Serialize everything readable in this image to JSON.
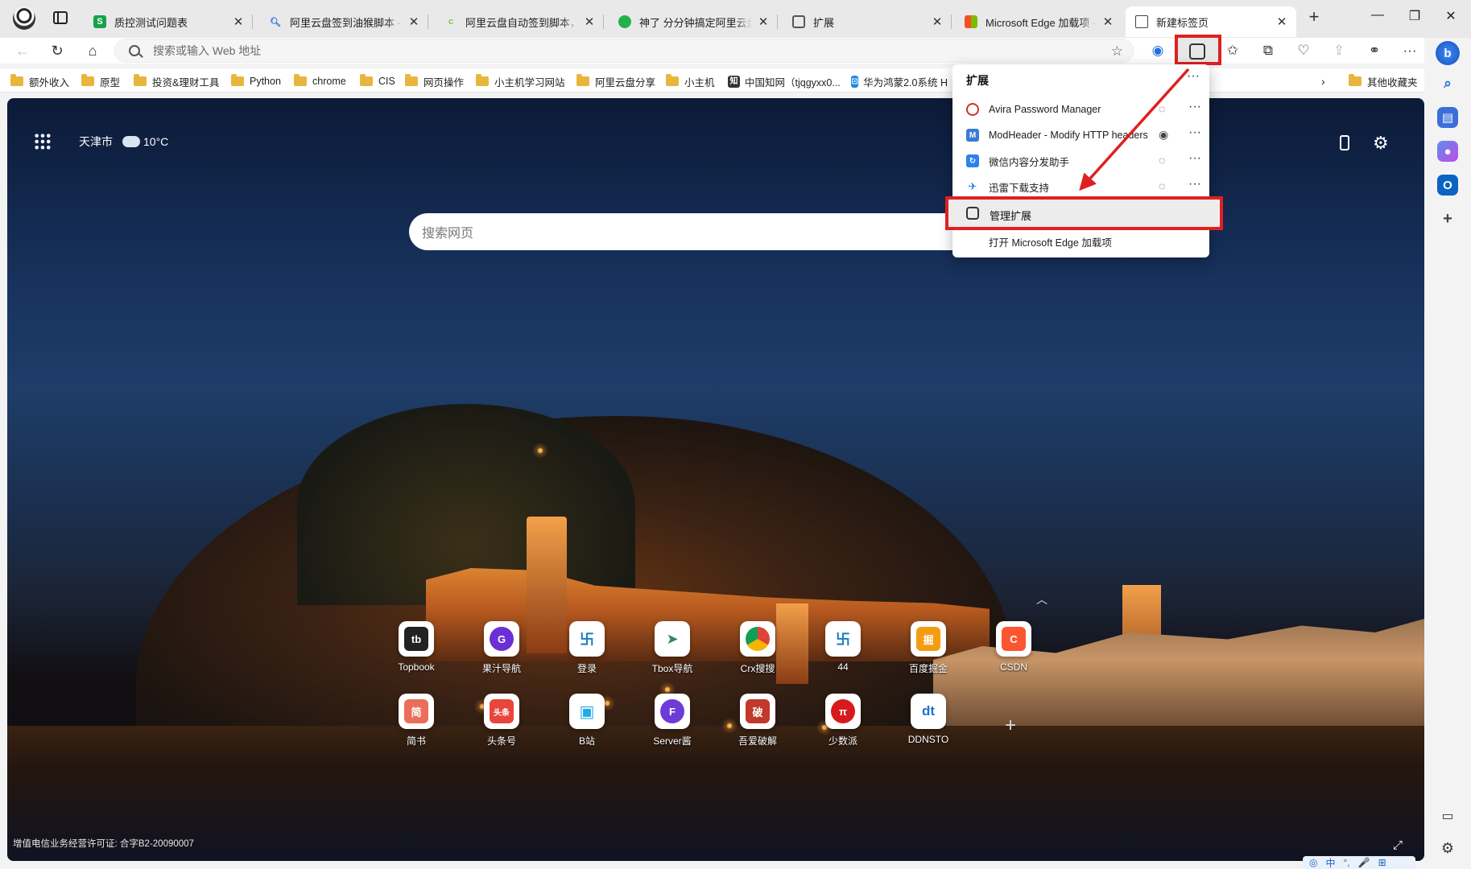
{
  "tabs": [
    {
      "title": "质控测试问题表",
      "fav_color": "#15a34a",
      "fav_text": "S"
    },
    {
      "title": "阿里云盘签到油猴脚本 - 搜",
      "fav_color": "#1e6fd9",
      "fav_text": "Q"
    },
    {
      "title": "阿里云盘自动签到脚本，适",
      "fav_color": "#7ac943",
      "fav_text": "c"
    },
    {
      "title": "神了 分分钟搞定阿里云盘自",
      "fav_color": "#20b24b",
      "fav_text": "●"
    },
    {
      "title": "扩展",
      "fav_color": "#666666",
      "fav_text": "⚙"
    },
    {
      "title": "Microsoft Edge 加载项 - Te",
      "fav_color": "#f25022",
      "fav_text": "■"
    },
    {
      "title": "新建标签页",
      "fav_color": "#555555",
      "fav_text": "▤"
    }
  ],
  "address": {
    "placeholder": "搜索或输入 Web 地址"
  },
  "bookmarks": [
    {
      "label": "额外收入",
      "type": "folder"
    },
    {
      "label": "原型",
      "type": "folder"
    },
    {
      "label": "投资&理财工具",
      "type": "folder"
    },
    {
      "label": "Python",
      "type": "folder"
    },
    {
      "label": "chrome",
      "type": "folder"
    },
    {
      "label": "CIS",
      "type": "folder"
    },
    {
      "label": "网页操作",
      "type": "folder"
    },
    {
      "label": "小主机学习网站",
      "type": "folder"
    },
    {
      "label": "阿里云盘分享",
      "type": "folder"
    },
    {
      "label": "小主机",
      "type": "folder"
    },
    {
      "label": "中国知网（tjqgyxx0...",
      "type": "link"
    },
    {
      "label": "华为鸿蒙2.0系统 H",
      "type": "link"
    },
    {
      "label": "其他收藏夹",
      "type": "folder"
    }
  ],
  "weather": {
    "city": "天津市",
    "temp": "10°C"
  },
  "search": {
    "placeholder": "搜索网页"
  },
  "quicklinks_row1": [
    {
      "label": "Topbook",
      "icon_color": "#222222",
      "glyph": "tb"
    },
    {
      "label": "果汁导航",
      "icon_color": "#6b2fd6",
      "glyph": "G"
    },
    {
      "label": "登录",
      "icon_color": "#1a7fc1",
      "glyph": "卐"
    },
    {
      "label": "Tbox导航",
      "icon_color": "#2e8b57",
      "glyph": "➤"
    },
    {
      "label": "Crx搜搜",
      "icon_color": "#db4437",
      "glyph": "◉"
    },
    {
      "label": "44",
      "icon_color": "#1a7fc1",
      "glyph": "卐"
    },
    {
      "label": "百度掘金",
      "icon_color": "#f39c12",
      "glyph": "掘"
    },
    {
      "label": "CSDN",
      "icon_color": "#fc5531",
      "glyph": "C"
    }
  ],
  "quicklinks_row2": [
    {
      "label": "简书",
      "icon_color": "#ea6f5a",
      "glyph": "简"
    },
    {
      "label": "头条号",
      "icon_color": "#e8453c",
      "glyph": "头条"
    },
    {
      "label": "B站",
      "icon_color": "#23ade5",
      "glyph": "▣"
    },
    {
      "label": "Server酱",
      "icon_color": "#6e3bd8",
      "glyph": "F"
    },
    {
      "label": "吾爱破解",
      "icon_color": "#c0392b",
      "glyph": "破"
    },
    {
      "label": "少数派",
      "icon_color": "#d71a1b",
      "glyph": "π"
    },
    {
      "label": "DDNSTO",
      "icon_color": "#1e6fd9",
      "glyph": "dt"
    }
  ],
  "license": "增值电信业务经营许可证: 合字B2-20090007",
  "extensions_menu": {
    "title": "扩展",
    "items": [
      {
        "name": "Avira Password Manager",
        "icon_color": "#d32f2f",
        "glyph": "ô"
      },
      {
        "name": "ModHeader - Modify HTTP headers",
        "icon_color": "#3b7bd8",
        "glyph": "M"
      },
      {
        "name": "微信内容分发助手",
        "icon_color": "#2f80ed",
        "glyph": "↻"
      },
      {
        "name": "迅雷下载支持",
        "icon_color": "#2f7ae5",
        "glyph": "✈"
      }
    ],
    "manage": "管理扩展",
    "open_addons": "打开 Microsoft Edge 加载项"
  },
  "ime": {
    "items": [
      "中",
      "°,",
      "🎤",
      "⊞"
    ]
  },
  "accent": "#e02020"
}
